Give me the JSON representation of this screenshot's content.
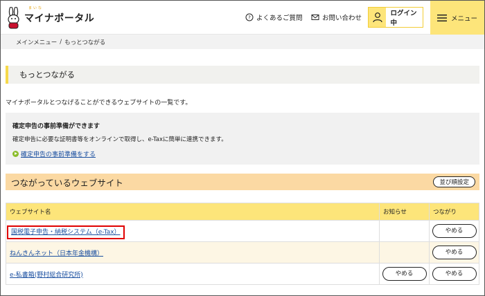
{
  "header": {
    "logo_text": "マイナポータル",
    "logo_ruby": "まいな",
    "faq_label": "よくあるご質問",
    "contact_label": "お問い合わせ",
    "login_label": "ログイン中",
    "menu_label": "メニュー"
  },
  "breadcrumb": {
    "home": "メインメニュー",
    "separator": "/",
    "current": "もっとつながる"
  },
  "page": {
    "title": "もっとつながる",
    "description": "マイナポータルとつなげることができるウェブサイトの一覧です。"
  },
  "info": {
    "title": "確定申告の事前準備ができます",
    "text": "確定申告に必要な証明書等をオンラインで取得し、e-Taxに簡単に連携できます。",
    "link": "確定申告の事前準備をする"
  },
  "section": {
    "title": "つながっているウェブサイト",
    "sort_button": "並び順設定"
  },
  "table": {
    "headers": [
      "ウェブサイト名",
      "お知らせ",
      "つながり"
    ],
    "rows": [
      {
        "name": "国税電子申告・納税システム（e-Tax）",
        "news_button": "",
        "conn_button": "やめる"
      },
      {
        "name": "ねんきんネット（日本年金機構）",
        "news_button": "",
        "conn_button": "やめる"
      },
      {
        "name": "e-私書箱(野村総合研究所)",
        "news_button": "やめる",
        "conn_button": "やめる"
      }
    ]
  },
  "colors": {
    "accent_yellow": "#fde57a",
    "section_orange": "#fbd9a3",
    "link_blue": "#1a4fa0",
    "highlight_red": "#e00000"
  }
}
